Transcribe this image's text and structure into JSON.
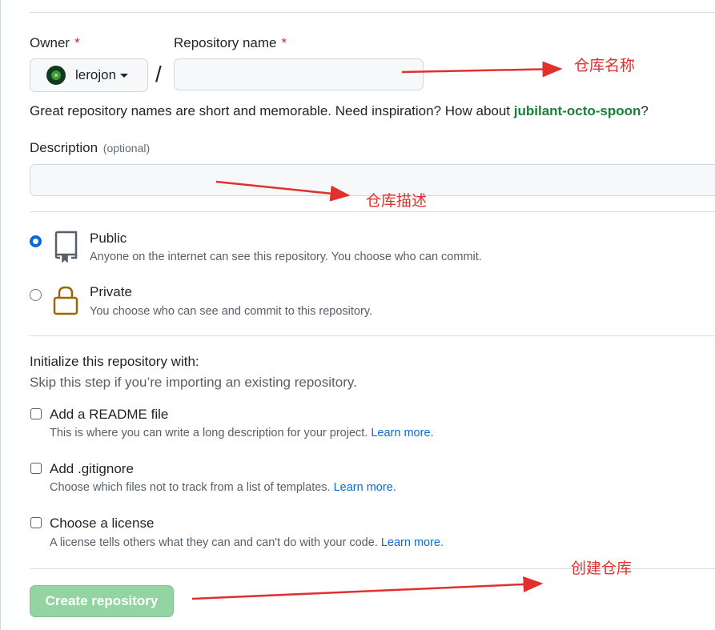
{
  "owner": {
    "label": "Owner",
    "required_mark": "*",
    "selected": "lerojon"
  },
  "repository": {
    "label": "Repository name",
    "required_mark": "*",
    "value": "",
    "separator": "/"
  },
  "name_hint": {
    "text": "Great repository names are short and memorable. Need inspiration? How about ",
    "suggestion": "jubilant-octo-spoon",
    "suffix": "?"
  },
  "description": {
    "label": "Description",
    "optional": "(optional)",
    "value": ""
  },
  "visibility": {
    "options": [
      {
        "title": "Public",
        "desc": "Anyone on the internet can see this repository. You choose who can commit.",
        "checked": true,
        "icon": "repo-icon"
      },
      {
        "title": "Private",
        "desc": "You choose who can see and commit to this repository.",
        "checked": false,
        "icon": "lock-icon"
      }
    ]
  },
  "initialize": {
    "title": "Initialize this repository with:",
    "subtitle": "Skip this step if you’re importing an existing repository.",
    "options": [
      {
        "title": "Add a README file",
        "desc": "This is where you can write a long description for your project.",
        "link": "Learn more.",
        "checked": false
      },
      {
        "title": "Add .gitignore",
        "desc": "Choose which files not to track from a list of templates.",
        "link": "Learn more.",
        "checked": false
      },
      {
        "title": "Choose a license",
        "desc": "A license tells others what they can and can't do with your code.",
        "link": "Learn more.",
        "checked": false
      }
    ]
  },
  "create_button": "Create repository",
  "annotations": {
    "repo_name": "仓库名称",
    "repo_desc": "仓库描述",
    "create": "创建仓库"
  },
  "colors": {
    "accent_green": "#1a7f37",
    "button_disabled_green": "#94d3a2",
    "link_blue": "#0969da",
    "annotation_red": "#e0312e",
    "lock_gold": "#9a6700"
  }
}
